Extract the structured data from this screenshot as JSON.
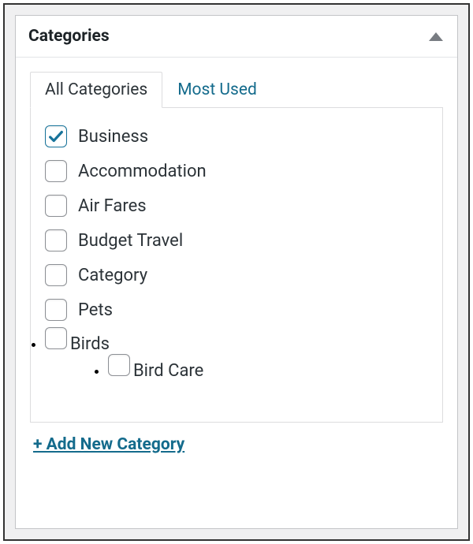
{
  "panel": {
    "title": "Categories"
  },
  "tabs": {
    "all": "All Categories",
    "most_used": "Most Used"
  },
  "categories": {
    "business": {
      "label": "Business",
      "checked": true
    },
    "accommodation": {
      "label": "Accommodation",
      "checked": false
    },
    "air_fares": {
      "label": "Air Fares",
      "checked": false
    },
    "budget_travel": {
      "label": "Budget Travel",
      "checked": false
    },
    "category": {
      "label": "Category",
      "checked": false
    },
    "pets": {
      "label": "Pets",
      "checked": false
    },
    "birds": {
      "label": "Birds",
      "checked": false
    },
    "bird_care": {
      "label": "Bird Care",
      "checked": false
    }
  },
  "actions": {
    "add_new": "+ Add New Category"
  },
  "colors": {
    "link": "#146b8c",
    "border": "#dcdcde",
    "text": "#2c3338"
  }
}
